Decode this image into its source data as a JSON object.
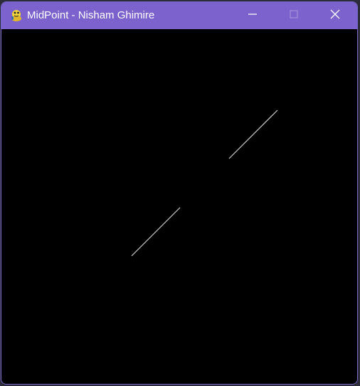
{
  "window": {
    "title": "MidPoint - Nisham Ghimire",
    "app_icon": "python-snake-icon",
    "controls": {
      "minimize_icon": "minimize-icon",
      "maximize_icon": "maximize-icon",
      "close_icon": "close-icon"
    },
    "titlebar_color": "#7b62cc",
    "canvas_color": "#000000"
  },
  "drawing": {
    "line_color": "#cfcfcf"
  }
}
